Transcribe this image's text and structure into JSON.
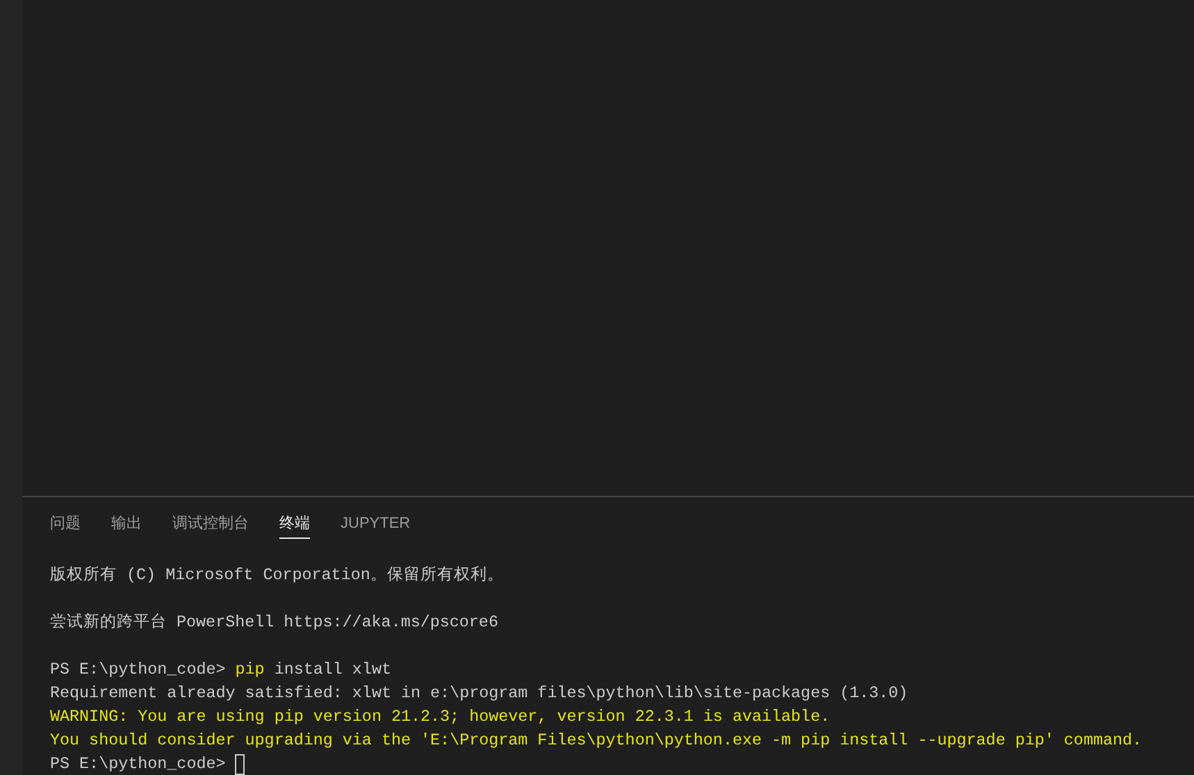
{
  "panel_tabs": [
    {
      "label": "问题",
      "selected": false
    },
    {
      "label": "输出",
      "selected": false
    },
    {
      "label": "调试控制台",
      "selected": false
    },
    {
      "label": "终端",
      "selected": true
    },
    {
      "label": "JUPYTER",
      "selected": false
    }
  ],
  "terminal": {
    "lines": [
      {
        "kind": "text",
        "segments": [
          {
            "kind": "output",
            "text": "版权所有 (C) Microsoft Corporation。保留所有权利。"
          }
        ]
      },
      {
        "kind": "blank"
      },
      {
        "kind": "text",
        "segments": [
          {
            "kind": "output",
            "text": "尝试新的跨平台 PowerShell https://aka.ms/pscore6"
          }
        ]
      },
      {
        "kind": "blank"
      },
      {
        "kind": "text",
        "segments": [
          {
            "kind": "output",
            "text": "PS E:\\python_code> "
          },
          {
            "kind": "command",
            "text": "pip"
          },
          {
            "kind": "output",
            "text": " install xlwt"
          }
        ]
      },
      {
        "kind": "text",
        "segments": [
          {
            "kind": "output",
            "text": "Requirement already satisfied: xlwt in e:\\program files\\python\\lib\\site-packages (1.3.0)"
          }
        ]
      },
      {
        "kind": "text",
        "segments": [
          {
            "kind": "warning",
            "text": "WARNING: You are using pip version 21.2.3; however, version 22.3.1 is available."
          }
        ]
      },
      {
        "kind": "text",
        "segments": [
          {
            "kind": "warning",
            "text": "You should consider upgrading via the 'E:\\Program Files\\python\\python.exe -m pip install --upgrade pip' command."
          }
        ]
      },
      {
        "kind": "text",
        "cursor": true,
        "segments": [
          {
            "kind": "output",
            "text": "PS E:\\python_code> "
          }
        ]
      }
    ]
  }
}
